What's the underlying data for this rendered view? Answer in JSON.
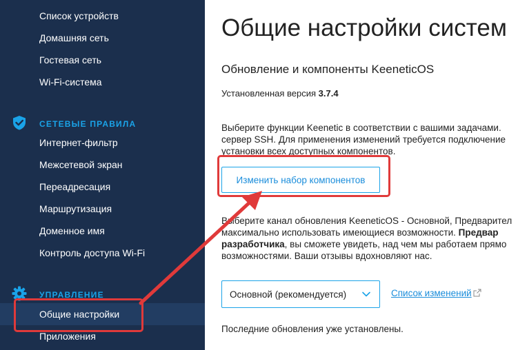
{
  "sidebar": {
    "items_top": [
      {
        "label": "Список устройств"
      },
      {
        "label": "Домашняя сеть"
      },
      {
        "label": "Гостевая сеть"
      },
      {
        "label": "Wi-Fi-система"
      }
    ],
    "network_rules": {
      "title": "СЕТЕВЫЕ ПРАВИЛА",
      "icon": "shield-icon",
      "items": [
        {
          "label": "Интернет-фильтр"
        },
        {
          "label": "Межсетевой экран"
        },
        {
          "label": "Переадресация"
        },
        {
          "label": "Маршрутизация"
        },
        {
          "label": "Доменное имя"
        },
        {
          "label": "Контроль доступа Wi-Fi"
        }
      ]
    },
    "management": {
      "title": "УПРАВЛЕНИЕ",
      "icon": "gear-icon",
      "items": [
        {
          "label": "Общие настройки",
          "active": true
        },
        {
          "label": "Приложения"
        }
      ]
    }
  },
  "main": {
    "page_title": "Общие настройки систем",
    "section_title": "Обновление и компоненты KeeneticOS",
    "version_label": "Установленная версия",
    "version_value": "3.7.4",
    "components_text": [
      "Выберите функции Keenetic в соответствии с вашими задачами.",
      "сервер SSH. Для применения изменений требуется подключение",
      "установки всех доступных компонентов."
    ],
    "components_button": "Изменить набор компонентов",
    "channel_text": {
      "line1": "Выберите канал обновления KeenetiсOS - Основной, Предварител",
      "line2_pre": "максимально использовать имеющиеся возможности.",
      "line2_bold": "Предвар",
      "line3_bold": "разработчика",
      "line3_post": ", вы сможете увидеть, над чем мы работаем прямо",
      "line4": "возможностями. Ваши отзывы вдохновляют нас."
    },
    "channel_select_value": "Основной (рекомендуется)",
    "changelog_link": "Список изменений",
    "status_text": "Последние обновления уже установлены."
  },
  "colors": {
    "sidebar_bg": "#1b2f4d",
    "accent": "#1aa3e8",
    "highlight": "#e03a3a"
  }
}
